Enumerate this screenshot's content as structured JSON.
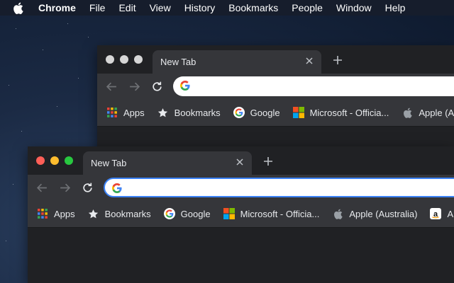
{
  "menubar": {
    "app_name": "Chrome",
    "items": [
      "File",
      "Edit",
      "View",
      "History",
      "Bookmarks",
      "People",
      "Window",
      "Help"
    ]
  },
  "back_window": {
    "tab_title": "New Tab",
    "omnibox": {
      "value": "",
      "placeholder": ""
    },
    "bookmarks": [
      {
        "label": "Apps",
        "icon": "apps-grid-icon"
      },
      {
        "label": "Bookmarks",
        "icon": "star-icon"
      },
      {
        "label": "Google",
        "icon": "google-icon"
      },
      {
        "label": "Microsoft - Officia...",
        "icon": "microsoft-icon"
      },
      {
        "label": "Apple (Aus",
        "icon": "apple-icon"
      }
    ]
  },
  "front_window": {
    "tab_title": "New Tab",
    "omnibox": {
      "value": "",
      "placeholder": ""
    },
    "bookmarks": [
      {
        "label": "Apps",
        "icon": "apps-grid-icon"
      },
      {
        "label": "Bookmarks",
        "icon": "star-icon"
      },
      {
        "label": "Google",
        "icon": "google-icon"
      },
      {
        "label": "Microsoft - Officia...",
        "icon": "microsoft-icon"
      },
      {
        "label": "Apple (Australia)",
        "icon": "apple-icon"
      },
      {
        "label": "Ama",
        "icon": "amazon-icon"
      }
    ]
  },
  "colors": {
    "traffic_close": "#ff5f57",
    "traffic_minimize": "#febc2e",
    "traffic_zoom": "#28c840",
    "focus_ring": "#3b82f6"
  }
}
